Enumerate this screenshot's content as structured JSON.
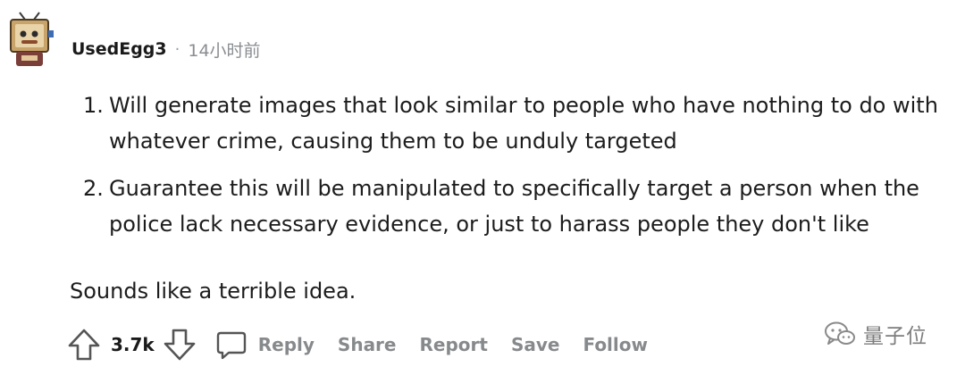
{
  "comment": {
    "author": "UsedEgg3",
    "separator": "·",
    "time": "14小时前",
    "points": [
      {
        "num": "1.",
        "text": "Will generate images that look similar to people who have nothing to do with whatever crime, causing them to be unduly targeted"
      },
      {
        "num": "2.",
        "text": "Guarantee this will be manipulated to specifically target a person when the police lack necessary evidence, or just to harass people they don't like"
      }
    ],
    "closing": "Sounds like a terrible idea."
  },
  "actions": {
    "vote_count": "3.7k",
    "reply": "Reply",
    "share": "Share",
    "report": "Report",
    "save": "Save",
    "follow": "Follow"
  },
  "watermark": {
    "text": "量子位"
  },
  "icons": {
    "upvote": "upvote-arrow-icon",
    "downvote": "downvote-arrow-icon",
    "reply": "speech-bubble-icon",
    "watermark": "wechat-logo-icon"
  },
  "colors": {
    "text": "#1a1a1b",
    "muted": "#878a8c",
    "watermark": "#7d7d7d"
  }
}
